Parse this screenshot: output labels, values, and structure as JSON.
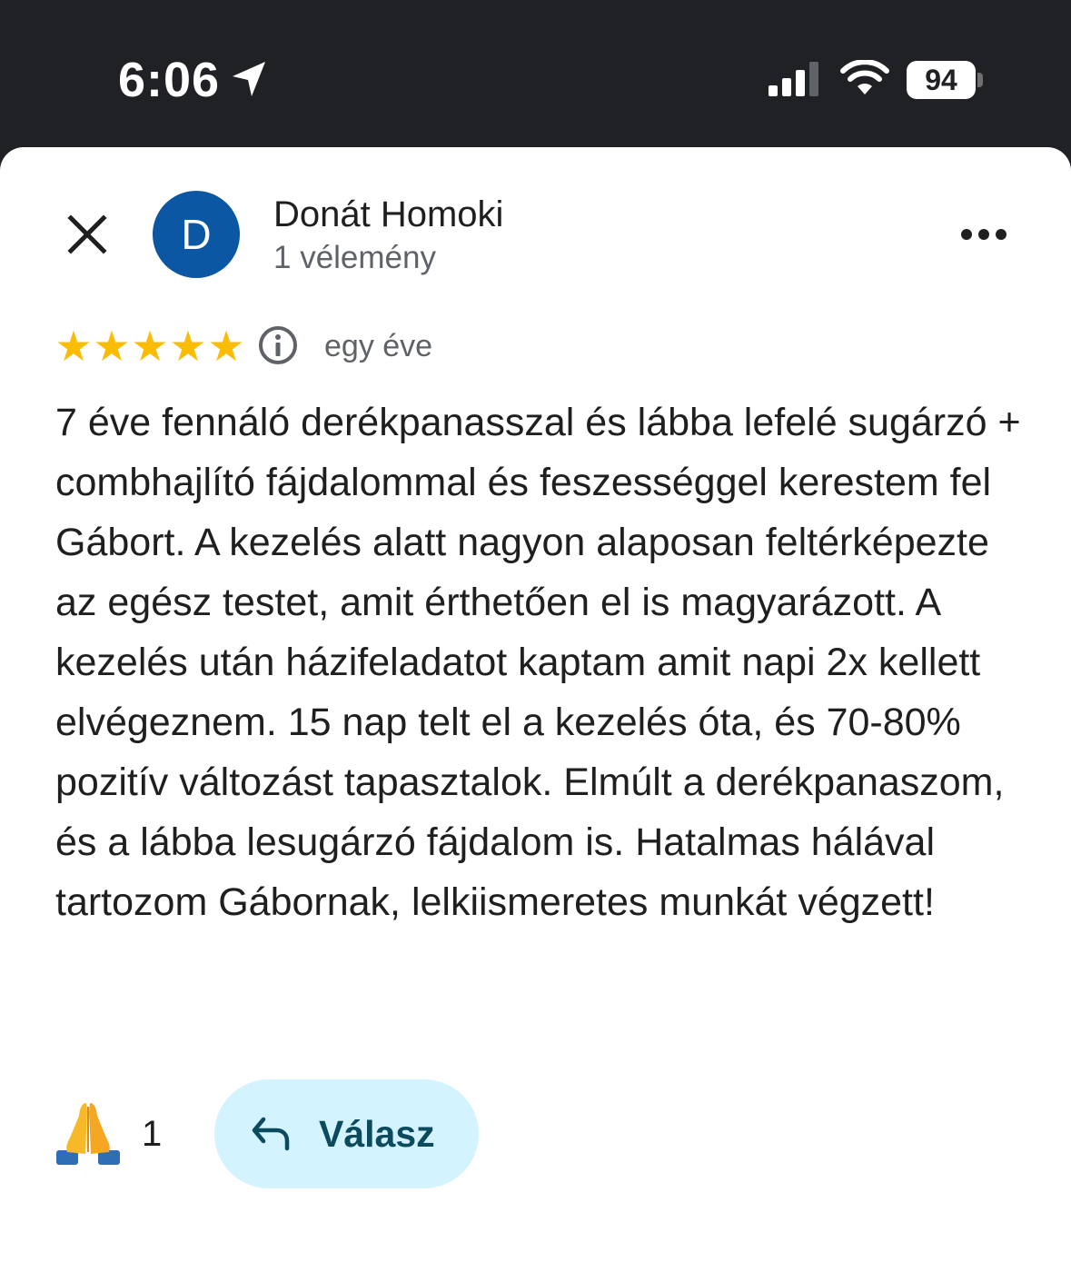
{
  "status_bar": {
    "time": "6:06",
    "battery": "94"
  },
  "review": {
    "reviewer_name": "Donát Homoki",
    "reviewer_initial": "D",
    "review_count": "1 vélemény",
    "rating": 5,
    "date": "egy éve",
    "text": "7 éve fennáló derékpanasszal és lábba lefelé sugárzó + combhajlító fájdalommal és feszességgel kerestem fel Gábort. A kezelés alatt nagyon alaposan feltérképezte az egész testet, amit érthetően el is magyarázott. A kezelés után házifeladatot kaptam amit napi 2x kellett elvégeznem. 15 nap telt el a kezelés óta, és 70-80% pozitív változást tapasztalok. Elmúlt a derékpanaszom, és a lábba lesugárzó fájdalom is. Hatalmas hálával tartozom Gábornak, lelkiismeretes munkát végzett!",
    "reaction_emoji": "🙏",
    "reaction_count": "1",
    "reply_label": "Válasz"
  },
  "colors": {
    "avatar": "#0b57a4",
    "stars": "#fbbc04",
    "reply_button_bg": "#d3f3ff",
    "reply_button_text": "#0c4a5e",
    "status_bar_bg": "#202124"
  },
  "icons": {
    "close": "close-icon",
    "more": "more-horizontal-icon",
    "info": "info-icon",
    "reply": "reply-arrow-icon",
    "location": "location-arrow-icon",
    "signal": "cellular-signal-icon",
    "wifi": "wifi-icon"
  }
}
